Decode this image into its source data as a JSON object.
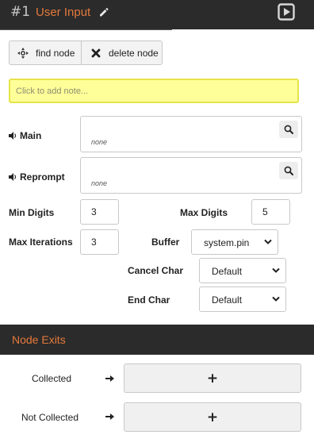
{
  "header": {
    "node_number": "#1",
    "title": "User Input"
  },
  "toolbar": {
    "find_label": "find node",
    "delete_label": "delete node"
  },
  "note": {
    "placeholder": "Click to add note..."
  },
  "prompts": {
    "main": {
      "label": "Main",
      "value": "none"
    },
    "reprompt": {
      "label": "Reprompt",
      "value": "none"
    }
  },
  "settings": {
    "min_digits": {
      "label": "Min Digits",
      "value": "3"
    },
    "max_digits": {
      "label": "Max Digits",
      "value": "5"
    },
    "max_iterations": {
      "label": "Max Iterations",
      "value": "3"
    },
    "buffer": {
      "label": "Buffer",
      "value": "system.pin"
    },
    "cancel_char": {
      "label": "Cancel Char",
      "value": "Default"
    },
    "end_char": {
      "label": "End Char",
      "value": "Default"
    }
  },
  "exits": {
    "title": "Node Exits",
    "items": [
      {
        "label": "Collected",
        "button": "+"
      },
      {
        "label": "Not Collected",
        "button": "+"
      }
    ]
  },
  "colors": {
    "header_bg": "#2b2b2b",
    "accent": "#e5793a",
    "note_bg": "#ffff99"
  }
}
